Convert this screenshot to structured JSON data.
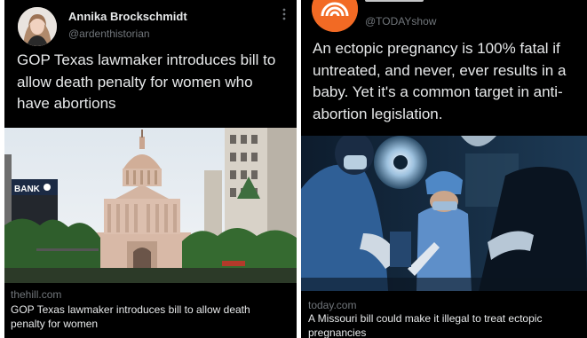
{
  "left_tweet": {
    "author_name": "Annika Brockschmidt",
    "author_handle": "@ardenthistorian",
    "more_icon": "more-dots-icon",
    "text": "GOP Texas lawmaker introduces bill to allow death penalty for women who have abortions",
    "card": {
      "domain": "thehill.com",
      "title": "GOP Texas lawmaker introduces bill to allow death penalty for women",
      "image_signs": {
        "bank_sign": "BANK"
      }
    }
  },
  "right_tweet": {
    "author_handle": "@TODAYshow",
    "text": "An ectopic pregnancy is 100% fatal if untreated, and never, ever results in a baby. Yet it's a common target in anti-abortion legislation.",
    "card": {
      "domain": "today.com",
      "title": "A Missouri bill could make it illegal to treat ectopic pregnancies"
    }
  },
  "colors": {
    "background": "#000000",
    "text_primary": "#e7e9ea",
    "text_secondary": "#71767b",
    "today_brand": "#f26a24"
  }
}
